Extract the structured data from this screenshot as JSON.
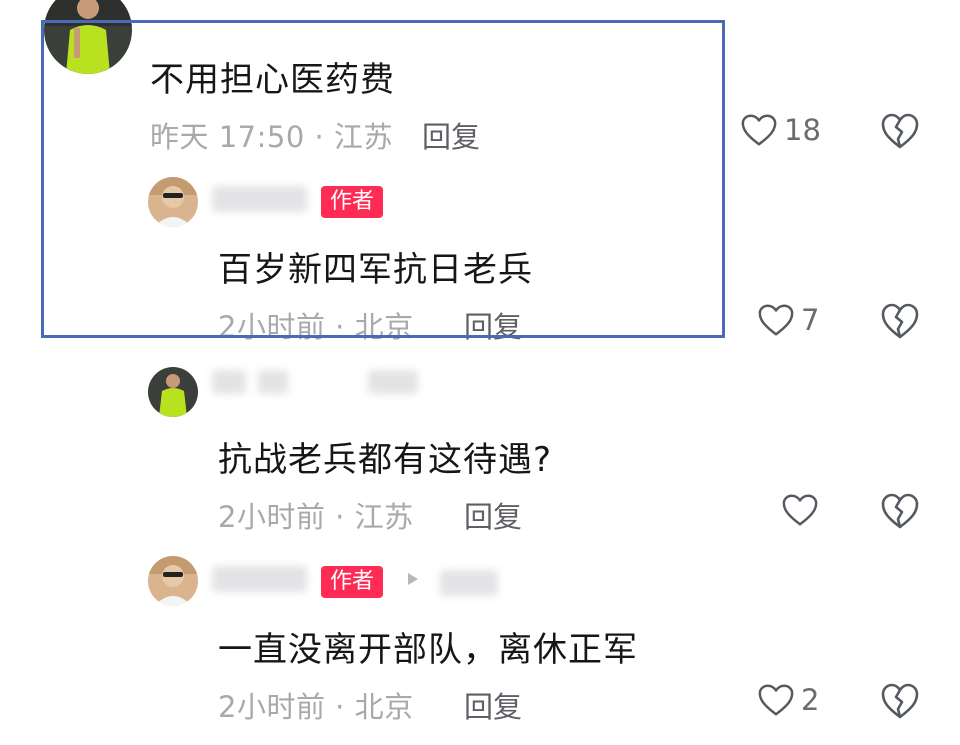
{
  "comments": [
    {
      "text": "不用担心医药费",
      "meta": "昨天 17:50 · 江苏",
      "reply_label": "回复",
      "like_count": "18"
    },
    {
      "badge": "作者",
      "text": "百岁新四军抗日老兵",
      "meta": "2小时前 · 北京",
      "reply_label": "回复",
      "like_count": "7"
    },
    {
      "text": "抗战老兵都有这待遇?",
      "meta": "2小时前 · 江苏",
      "reply_label": "回复",
      "like_count": ""
    },
    {
      "badge": "作者",
      "text": "一直没离开部队，离休正军",
      "meta": "2小时前 · 北京",
      "reply_label": "回复",
      "like_count": "2"
    }
  ],
  "colors": {
    "author_badge": "#fe2c55",
    "highlight": "#4a6ab8",
    "meta_text": "#a9a9ad"
  },
  "icons": [
    "heart-outline-icon",
    "broken-heart-icon",
    "play-triangle-icon"
  ]
}
